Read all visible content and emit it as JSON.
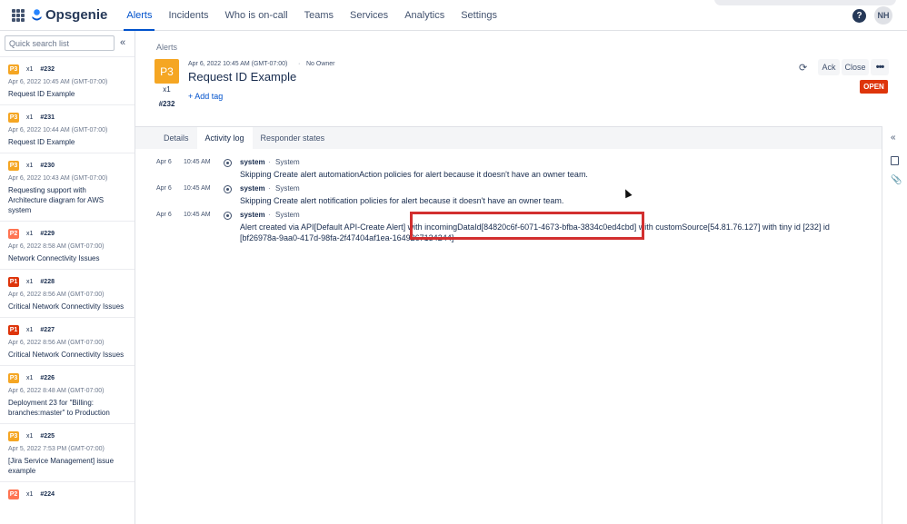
{
  "topnav": {
    "brand": "Opsgenie",
    "items": [
      "Alerts",
      "Incidents",
      "Who is on-call",
      "Teams",
      "Services",
      "Analytics",
      "Settings"
    ],
    "active_item": "Alerts",
    "help_label": "?",
    "avatar_initials": "NH",
    "brand_color": "#0052cc"
  },
  "sidebar": {
    "search_placeholder": "Quick search list",
    "collapse_icon": "double-chevron-left-icon",
    "alerts": [
      {
        "priority": "P3",
        "count": "x1",
        "number": "#232",
        "date": "Apr 6, 2022 10:45 AM (GMT-07:00)",
        "title": "Request ID Example"
      },
      {
        "priority": "P3",
        "count": "x1",
        "number": "#231",
        "date": "Apr 6, 2022 10:44 AM (GMT-07:00)",
        "title": "Request ID Example"
      },
      {
        "priority": "P3",
        "count": "x1",
        "number": "#230",
        "date": "Apr 6, 2022 10:43 AM (GMT-07:00)",
        "title": "Requesting support with Architecture diagram for AWS system"
      },
      {
        "priority": "P2",
        "count": "x1",
        "number": "#229",
        "date": "Apr 6, 2022 8:58 AM (GMT-07:00)",
        "title": "Network Connectivity Issues"
      },
      {
        "priority": "P1",
        "count": "x1",
        "number": "#228",
        "date": "Apr 6, 2022 8:56 AM (GMT-07:00)",
        "title": "Critical Network Connectivity Issues"
      },
      {
        "priority": "P1",
        "count": "x1",
        "number": "#227",
        "date": "Apr 6, 2022 8:56 AM (GMT-07:00)",
        "title": "Critical Network Connectivity Issues"
      },
      {
        "priority": "P3",
        "count": "x1",
        "number": "#226",
        "date": "Apr 6, 2022 8:48 AM (GMT-07:00)",
        "title": "Deployment 23 for \"Billing: branches:master\" to Production"
      },
      {
        "priority": "P3",
        "count": "x1",
        "number": "#225",
        "date": "Apr 5, 2022 7:53 PM (GMT-07:00)",
        "title": "[Jira Service Management] issue example"
      },
      {
        "priority": "P2",
        "count": "x1",
        "number": "#224",
        "date": "",
        "title": ""
      }
    ]
  },
  "alert": {
    "breadcrumb": "Alerts",
    "priority": "P3",
    "count": "x1",
    "number": "#232",
    "date": "Apr 6, 2022 10:45 AM (GMT-07:00)",
    "separator": "·",
    "owner": "No Owner",
    "title": "Request ID Example",
    "add_tag": "+ Add tag",
    "ack_label": "Ack",
    "close_label": "Close",
    "more_label": "•••",
    "status": "OPEN"
  },
  "tabs": {
    "items": [
      "Details",
      "Activity log",
      "Responder states"
    ],
    "active": "Activity log"
  },
  "activity_log": [
    {
      "date": "Apr 6",
      "time": "10:45 AM",
      "user": "system",
      "source": "System",
      "message": "Skipping Create alert automationAction policies for alert because it doesn't have an owner team."
    },
    {
      "date": "Apr 6",
      "time": "10:45 AM",
      "user": "system",
      "source": "System",
      "message": "Skipping Create alert notification policies for alert because it doesn't have an owner team."
    },
    {
      "date": "Apr 6",
      "time": "10:45 AM",
      "user": "system",
      "source": "System",
      "message": "Alert created via API[Default API-Create Alert] with incomingDataId[84820c6f-6071-4673-bfba-3834c0ed4cbd] with customSource[54.81.76.127] with tiny id [232] id [bf26978a-9aa0-417d-98fa-2f47404af1ea-1649267134244]"
    }
  ]
}
